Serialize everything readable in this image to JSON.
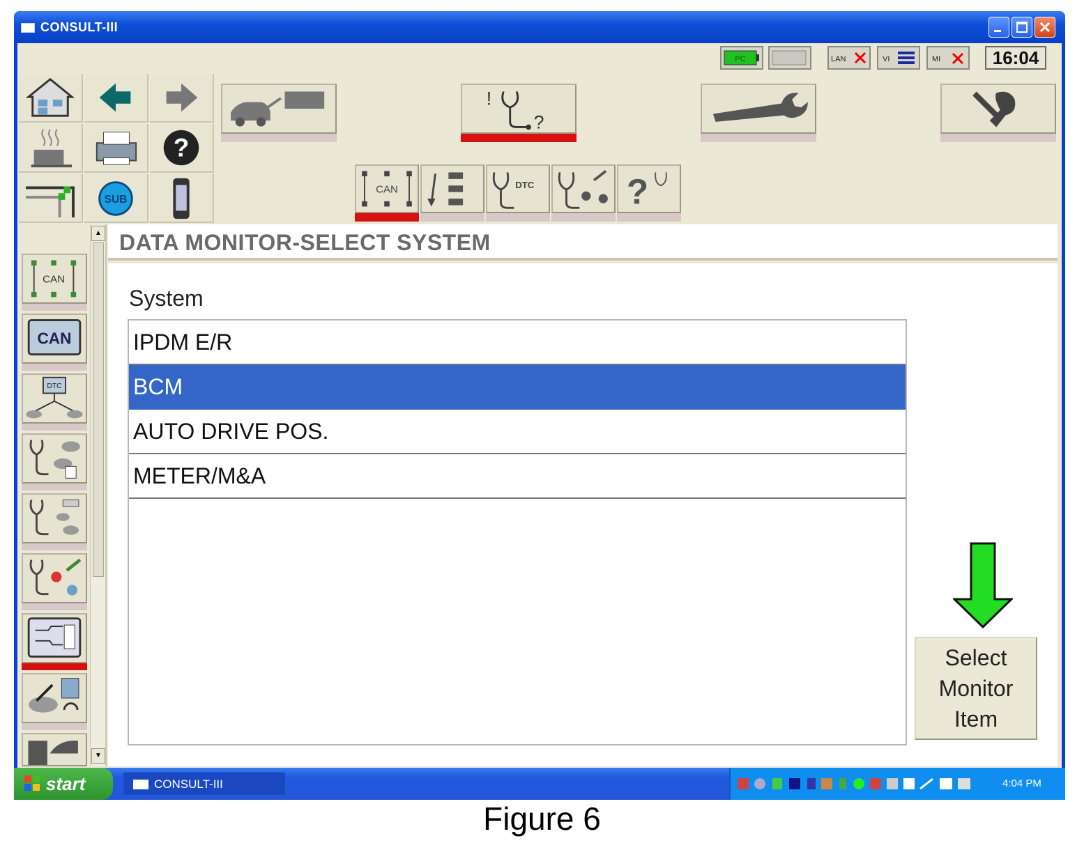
{
  "window": {
    "title": "CONSULT-III"
  },
  "status": {
    "pc_label": "PC",
    "lan_label": "LAN",
    "vi_label": "VI",
    "mi_label": "MI",
    "clock": "16:04"
  },
  "sidebar_labels": {
    "can_diagram": "CAN",
    "can_screen": "CAN",
    "dtc": "DTC",
    "sub": "SUB"
  },
  "toolbar_labels": {
    "can": "CAN",
    "dtc": "DTC"
  },
  "header": {
    "title": "DATA MONITOR-SELECT SYSTEM"
  },
  "main": {
    "column_label": "System",
    "systems": [
      "IPDM E/R",
      "BCM",
      "AUTO DRIVE POS.",
      "METER/M&A"
    ],
    "selected_index": 1,
    "select_button": [
      "Select",
      "Monitor",
      "Item"
    ]
  },
  "taskbar": {
    "start_label": "start",
    "task_label": "CONSULT-III",
    "tray_time": "4:04 PM"
  },
  "caption": "Figure 6",
  "colors": {
    "selection": "#3366c6",
    "active_tab_bar": "#d81010",
    "arrow": "#22dd22"
  }
}
